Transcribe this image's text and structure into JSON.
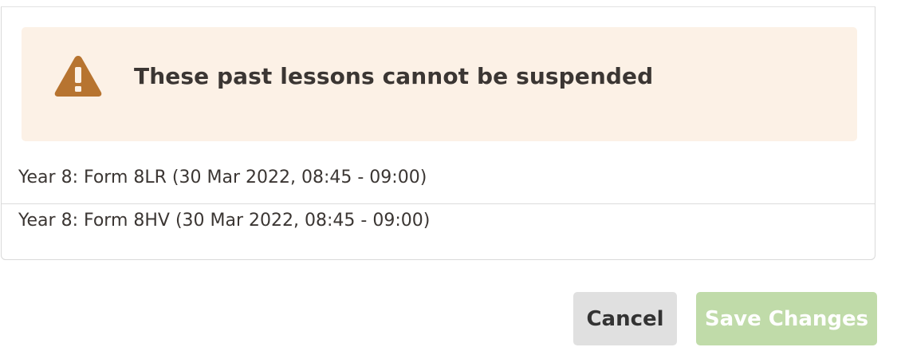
{
  "warning": {
    "icon": "warning-triangle-icon",
    "color": "#b77430",
    "background": "#fcf1e6",
    "title": "These past lessons cannot be suspended"
  },
  "lessons": [
    "Year 8: Form 8LR (30 Mar 2022, 08:45 - 09:00)",
    "Year 8: Form 8HV (30 Mar 2022, 08:45 - 09:00)"
  ],
  "actions": {
    "cancel_label": "Cancel",
    "save_label": "Save Changes",
    "save_color": "#c0dba9"
  }
}
